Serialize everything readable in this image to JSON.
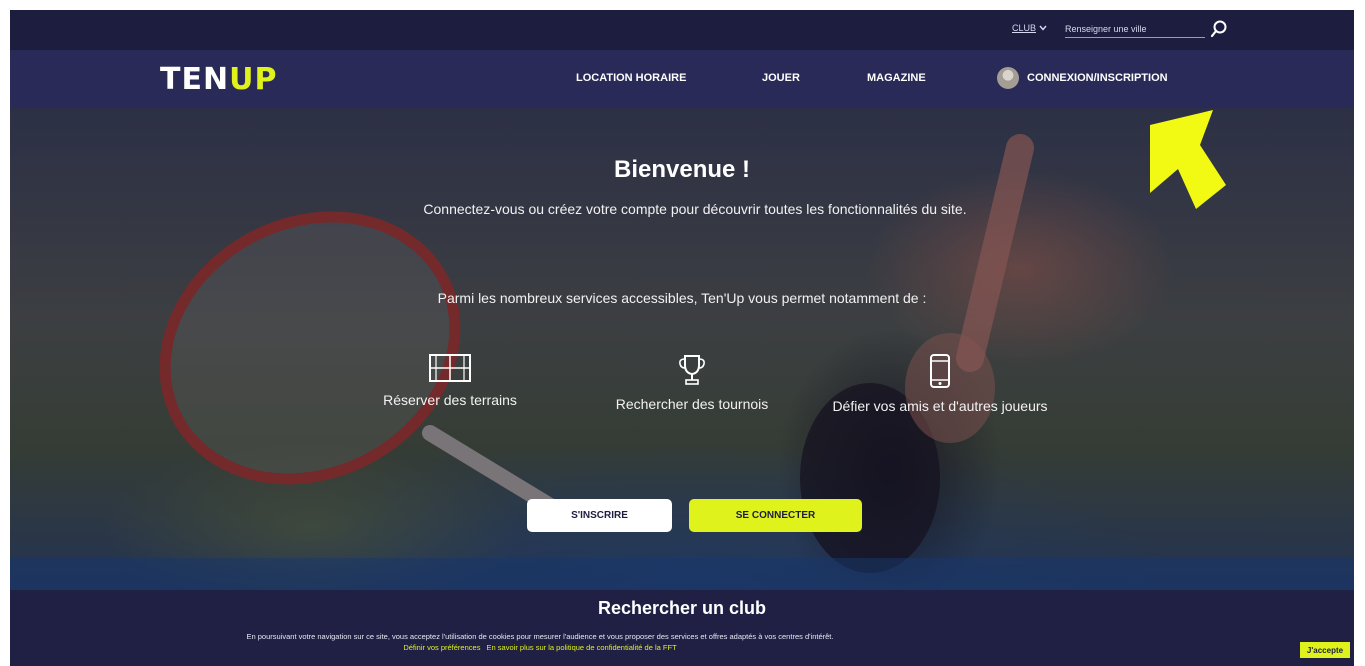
{
  "topbar": {
    "club_select": "CLUB",
    "city_placeholder": "Renseigner une ville"
  },
  "nav": {
    "logo_ten": "TEN",
    "logo_up": "UP",
    "items": [
      "LOCATION HORAIRE",
      "JOUER",
      "MAGAZINE"
    ],
    "login": "CONNEXION/INSCRIPTION"
  },
  "hero": {
    "title": "Bienvenue !",
    "subtitle": "Connectez-vous ou créez votre compte pour découvrir toutes les fonctionnalités du site.",
    "lead": "Parmi les nombreux services accessibles, Ten'Up vous permet notamment de :",
    "features": [
      {
        "icon": "court-icon",
        "label": "Réserver des terrains"
      },
      {
        "icon": "trophy-icon",
        "label": "Rechercher des tournois"
      },
      {
        "icon": "phone-icon",
        "label": "Défier vos amis et d'autres joueurs"
      }
    ],
    "signup_label": "S'INSCRIRE",
    "login_label": "SE CONNECTER"
  },
  "club_search": {
    "title": "Rechercher un club"
  },
  "cookie": {
    "text": "En poursuivant votre navigation sur ce site, vous acceptez l'utilisation de cookies pour mesurer l'audience et vous proposer des services et offres adaptés à vos centres d'intérêt.",
    "prefs_link": "Définir vos préférences",
    "policy_link": "En savoir plus sur la politique de confidentialité de la FFT",
    "accept": "J'accepte"
  },
  "colors": {
    "brand_navy": "#292a57",
    "accent_yellow": "#dff21b",
    "arrow_yellow": "#f2fa14"
  }
}
